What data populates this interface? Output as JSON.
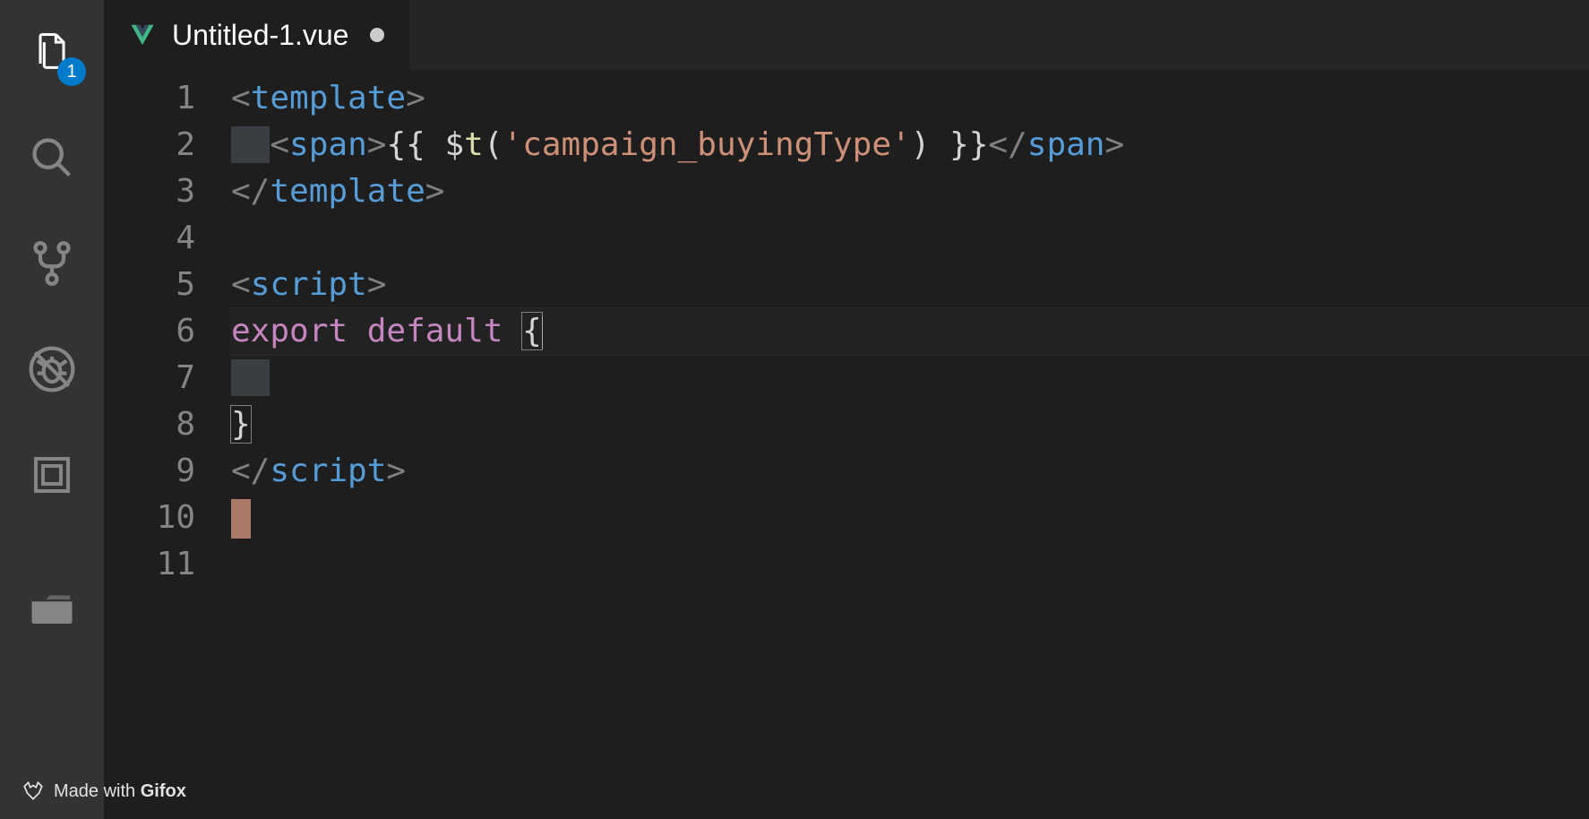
{
  "activityBar": {
    "explorerBadge": "1"
  },
  "tab": {
    "title": "Untitled-1.vue"
  },
  "code": {
    "lineNumbers": [
      "1",
      "2",
      "3",
      "4",
      "5",
      "6",
      "7",
      "8",
      "9",
      "10",
      "11"
    ],
    "line1": {
      "lt": "<",
      "tag": "template",
      "gt": ">"
    },
    "line2": {
      "indent": "  ",
      "lt": "<",
      "tag": "span",
      "gt": ">",
      "open": "{{ ",
      "dollar": "$",
      "fn": "t",
      "lp": "(",
      "str": "'campaign_buyingType'",
      "rp": ")",
      "close": " }}",
      "clt": "</",
      "ctag": "span",
      "cgt": ">"
    },
    "line3": {
      "clt": "</",
      "tag": "template",
      "gt": ">"
    },
    "line5": {
      "lt": "<",
      "tag": "script",
      "gt": ">"
    },
    "line6": {
      "kw1": "export",
      "sp": " ",
      "kw2": "default",
      "sp2": " ",
      "brace": "{"
    },
    "line7": {
      "indent": "  "
    },
    "line8": {
      "brace": "}"
    },
    "line9": {
      "clt": "</",
      "tag": "script",
      "gt": ">"
    },
    "line10": {
      "err": " "
    }
  },
  "watermark": {
    "prefix": "Made with ",
    "brand": "Gifox"
  }
}
